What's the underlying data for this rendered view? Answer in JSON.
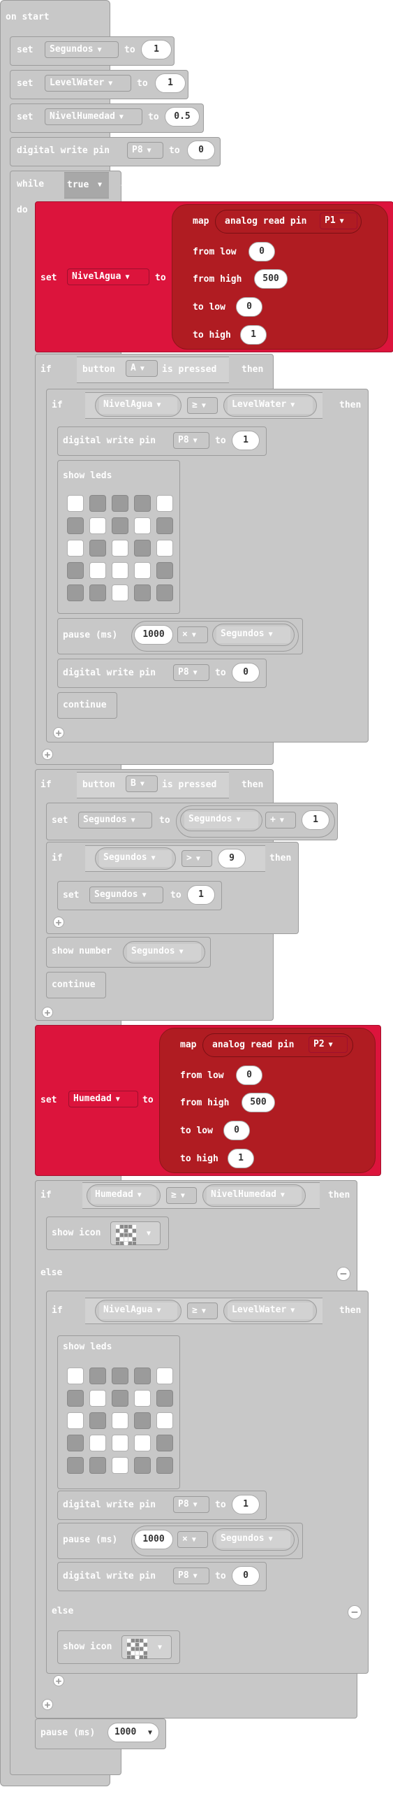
{
  "on_start": "on start",
  "kw": {
    "set": "set",
    "to": "to",
    "while": "while",
    "do": "do",
    "if": "if",
    "then": "then",
    "else": "else",
    "map": "map",
    "from_low": "from low",
    "from_high": "from high",
    "to_low": "to low",
    "to_high": "to high",
    "digital_write": "digital write pin",
    "analog_read": "analog read pin",
    "show_leds": "show leds",
    "pause": "pause (ms)",
    "continue": "continue",
    "show_number": "show number",
    "show_icon": "show icon",
    "button": "button",
    "is_pressed": "is pressed",
    "true": "true"
  },
  "vars": {
    "segundos": "Segundos",
    "levelwater": "LevelWater",
    "nivelhumedad": "NivelHumedad",
    "nivelagua": "NivelAgua",
    "humedad": "Humedad"
  },
  "pins": {
    "p8": "P8",
    "p1": "P1",
    "p2": "P2"
  },
  "buttons": {
    "a": "A",
    "b": "B"
  },
  "ops": {
    "ge": "≥",
    "gt": ">",
    "times": "×",
    "plus": "+"
  },
  "values": {
    "v1": "1",
    "v05": "0.5",
    "v0": "0",
    "v500": "500",
    "v1000": "1000",
    "v9": "9"
  },
  "icons": {
    "arrow": "dropdown-arrow-icon",
    "plus": "+",
    "minus": "−"
  },
  "leds_1": [
    1,
    0,
    0,
    0,
    1,
    0,
    1,
    0,
    1,
    0,
    1,
    0,
    1,
    0,
    1,
    0,
    1,
    1,
    1,
    0,
    0,
    0,
    1,
    0,
    0
  ],
  "leds_2": [
    1,
    0,
    0,
    0,
    1,
    0,
    1,
    0,
    1,
    0,
    1,
    0,
    0,
    0,
    1,
    0,
    1,
    1,
    1,
    0,
    0,
    0,
    1,
    0,
    0
  ]
}
